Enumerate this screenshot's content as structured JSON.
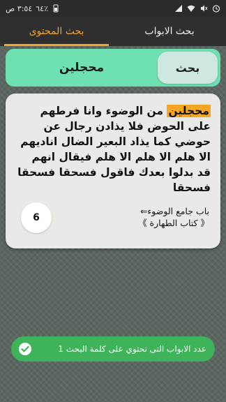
{
  "status_bar": {
    "time": "٣:٥٤ ص",
    "battery": "٦٤٪"
  },
  "tabs": [
    {
      "label": "بحث الابواب",
      "active": false
    },
    {
      "label": "بحث المحتوى",
      "active": true
    }
  ],
  "search": {
    "query": "محجلين",
    "button_label": "بحث"
  },
  "result": {
    "highlight": "محجلين",
    "text": " من الوضوء وانا فرطهم على الحوض فلا يذادن رجال عن حوضي كما يذاد البعير الضال اناديهم الا هلم الا هلم الا هلم فيقال انهم قد بدلوا بعدك فاقول فسحقا فسحقا فسحقا",
    "source_line1": "باب جامع الوضوء⇐",
    "source_line2": "《 كتاب الطهارة 》",
    "number": "6"
  },
  "toast": {
    "text": "عدد الابواب التى تحتوي على كلمة البحث 1"
  },
  "colors": {
    "accent": "#f5a623",
    "search_bg": "#6ee0b2",
    "toast_bg": "#3fb35a",
    "header_bg": "#2f2f2f"
  }
}
